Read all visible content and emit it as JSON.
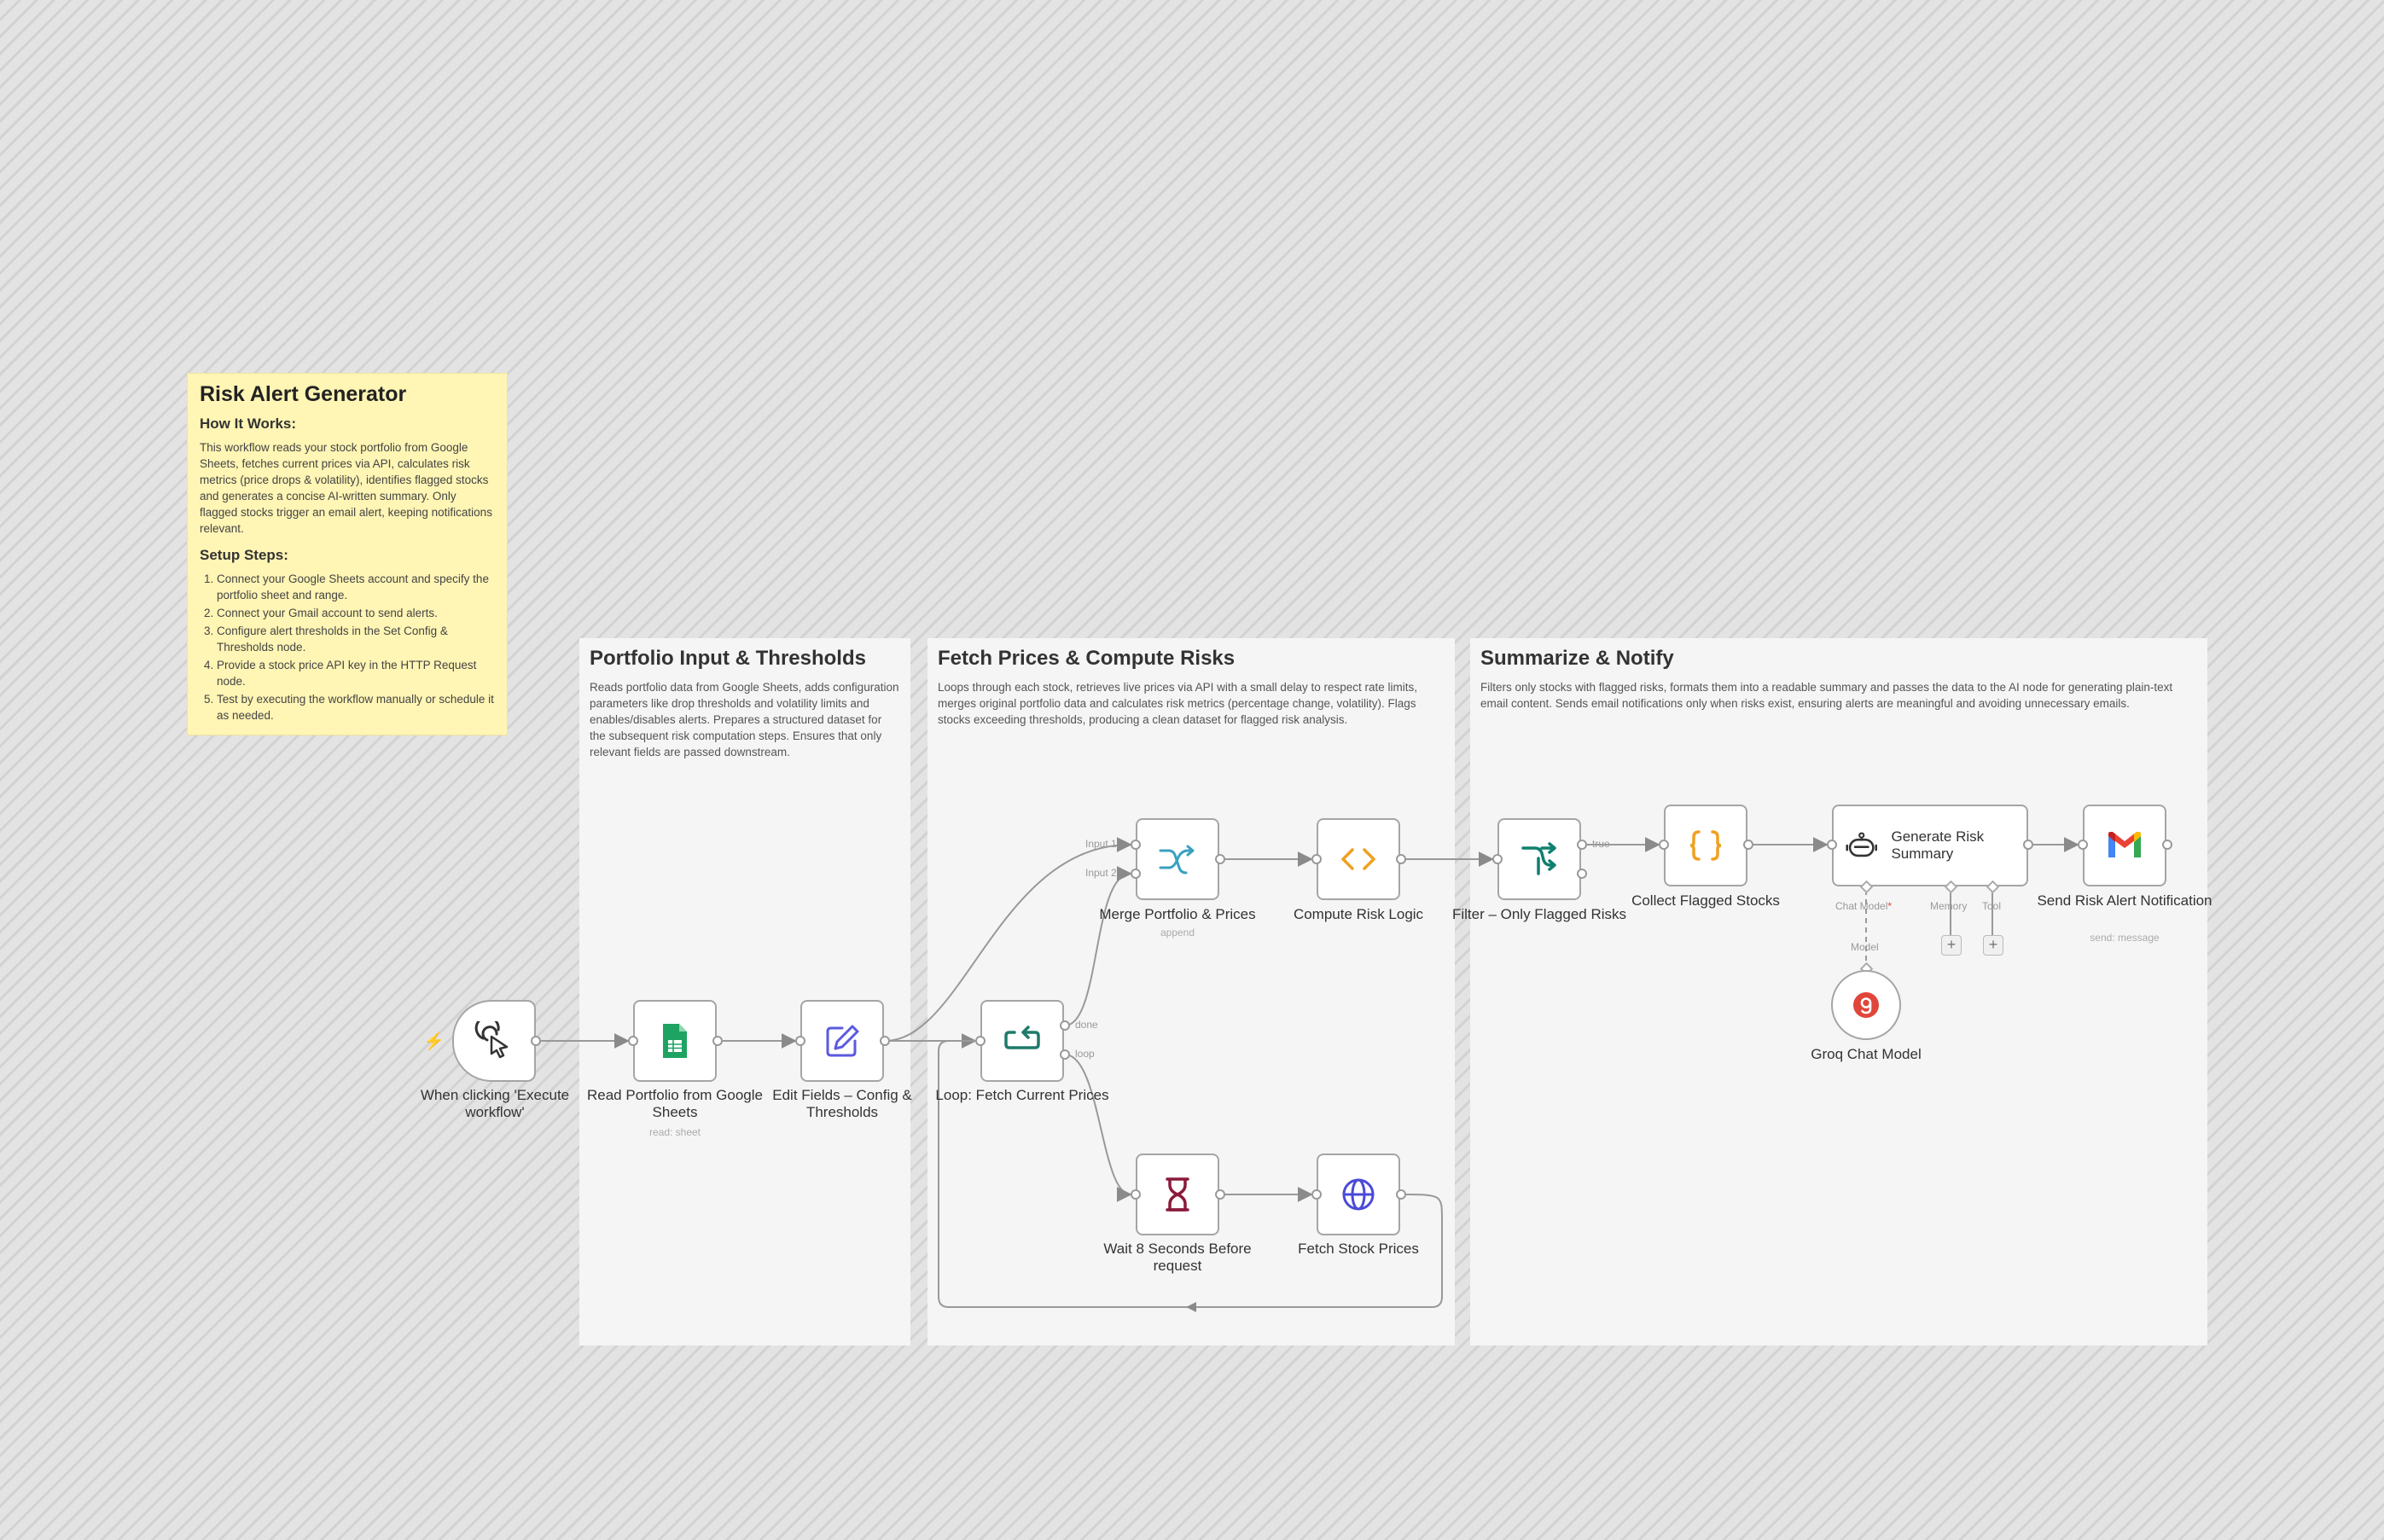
{
  "sticky": {
    "title": "Risk Alert Generator",
    "how_heading": "How It Works:",
    "how_text": "This workflow reads your stock portfolio from Google Sheets, fetches current prices via API, calculates risk metrics (price drops & volatility), identifies flagged stocks and generates a concise AI-written summary. Only flagged stocks trigger an email alert, keeping notifications relevant.",
    "setup_heading": "Setup Steps:",
    "steps": [
      "Connect your Google Sheets account and specify the portfolio sheet and range.",
      "Connect your Gmail account to send alerts.",
      "Configure alert thresholds in the Set Config & Thresholds node.",
      "Provide a stock price API key in the HTTP Request node.",
      "Test by executing the workflow manually or schedule it as needed."
    ]
  },
  "sections": {
    "portfolio": {
      "title": "Portfolio Input & Thresholds",
      "text": "Reads portfolio data from Google Sheets, adds configuration parameters like drop thresholds and volatility limits and enables/disables alerts. Prepares a structured dataset for the subsequent risk computation steps. Ensures that only relevant fields are passed downstream."
    },
    "fetch": {
      "title": "Fetch Prices & Compute Risks",
      "text": "Loops through each stock, retrieves live prices via API with a small delay to respect rate limits, merges original portfolio data and calculates risk metrics (percentage change, volatility). Flags stocks exceeding thresholds, producing a clean dataset for flagged risk analysis."
    },
    "summarize": {
      "title": "Summarize & Notify",
      "text": "Filters only stocks with flagged risks, formats them into a readable summary and passes the data to the AI node for generating plain-text email content. Sends email notifications only when risks exist, ensuring alerts are meaningful and avoiding unnecessary emails."
    }
  },
  "nodes": {
    "trigger": "When clicking 'Execute workflow'",
    "sheets": "Read Portfolio from Google Sheets",
    "sheets_sub": "read: sheet",
    "edit": "Edit Fields – Config & Thresholds",
    "loop": "Loop: Fetch Current Prices",
    "merge": "Merge Portfolio & Prices",
    "merge_sub": "append",
    "compute": "Compute Risk Logic",
    "wait": "Wait 8 Seconds Before request",
    "fetch": "Fetch Stock Prices",
    "filter": "Filter – Only Flagged Risks",
    "collect": "Collect Flagged Stocks",
    "generate": "Generate Risk Summary",
    "send": "Send Risk Alert Notification",
    "send_sub": "send: message",
    "groq": "Groq Chat Model"
  },
  "ports": {
    "input1": "Input 1",
    "input2": "Input 2",
    "done": "done",
    "loop": "loop",
    "true": "true",
    "chat_model": "Chat Model",
    "required": "*",
    "memory": "Memory",
    "tool": "Tool",
    "model": "Model",
    "plus": "+"
  },
  "colors": {
    "sheets_green": "#1ea362",
    "edit_indigo": "#5a5ae0",
    "loop_teal": "#1f7a6a",
    "merge_teal": "#3aa0c0",
    "code_orange": "#f0a020",
    "wait_maroon": "#8a1a3a",
    "http_blue": "#4a4ad8",
    "filter_teal": "#0f8070",
    "groq_red": "#e0463a",
    "trigger_marker": "#ff6a33"
  }
}
